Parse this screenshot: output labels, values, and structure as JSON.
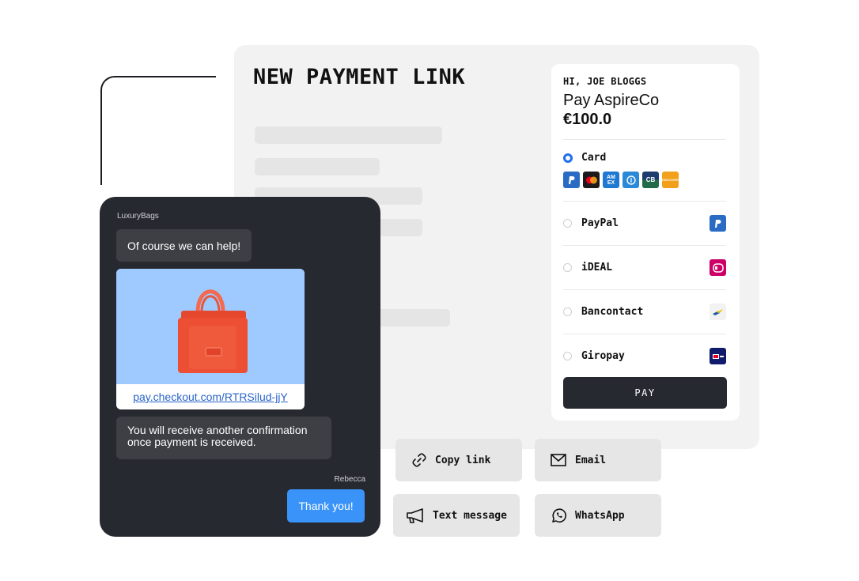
{
  "panel": {
    "title": "NEW PAYMENT LINK"
  },
  "checkout": {
    "greeting": "HI, JOE BLOGGS",
    "pay_to": "Pay AspireCo",
    "amount": "€100.0",
    "selected_method": "Card",
    "card_option": {
      "label": "Card",
      "brands": [
        {
          "name": "paypal-icon",
          "text": "P",
          "color": "#2a6cc4"
        },
        {
          "name": "mastercard-icon",
          "text": "",
          "color": "#1b1b1b"
        },
        {
          "name": "amex-icon",
          "text": "AM EX",
          "color": "#1f78d1"
        },
        {
          "name": "diners-icon",
          "text": "◎",
          "color": "#2b8ad8"
        },
        {
          "name": "cb-icon",
          "text": "CB",
          "color": "#1d3b6e"
        },
        {
          "name": "discover-icon",
          "text": "DISCOVER",
          "color": "#f2a01c"
        }
      ]
    },
    "methods": [
      {
        "label": "PayPal",
        "icon": "paypal-icon",
        "color": "#2a6cc4",
        "glyph": "P"
      },
      {
        "label": "iDEAL",
        "icon": "ideal-icon",
        "color": "#cc0066",
        "glyph": "iD"
      },
      {
        "label": "Bancontact",
        "icon": "bancontact-icon",
        "color": "#f2f2f2",
        "glyph": ""
      },
      {
        "label": "Giropay",
        "icon": "giropay-icon",
        "color": "#0f1c6b",
        "glyph": "giro"
      }
    ],
    "pay_button": "PAY"
  },
  "share": {
    "copy_link": "Copy link",
    "email": "Email",
    "text_message": "Text message",
    "whatsapp": "WhatsApp"
  },
  "chat": {
    "merchant_name": "LuxuryBags",
    "message_1": "Of course we can help!",
    "product_link": "pay.checkout.com/RTRSilud-jjY",
    "message_2_line1": "You will receive another confirmation",
    "message_2_line2": "once payment is received.",
    "customer_name": "Rebecca",
    "reply": "Thank you!"
  }
}
